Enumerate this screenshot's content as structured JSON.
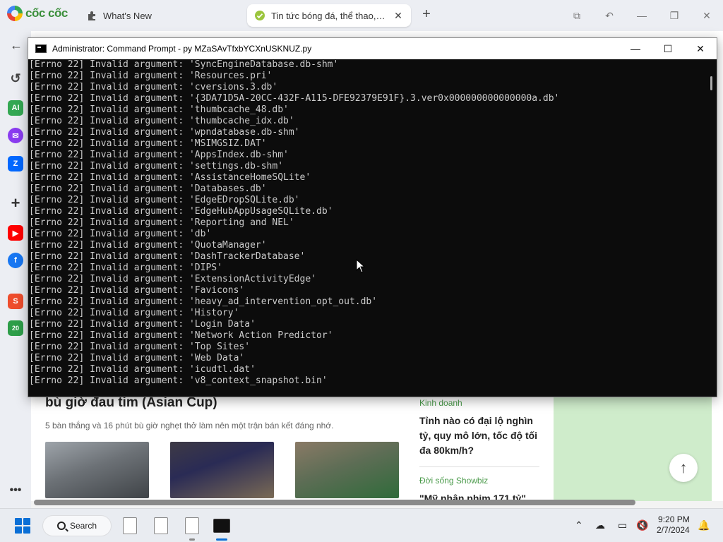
{
  "browser": {
    "brand": "cốc cốc",
    "tabs": [
      {
        "title": "What's New"
      },
      {
        "title": "Tin tức bóng đá, thể thao, giải trí"
      }
    ],
    "new_tab": "+"
  },
  "cmd": {
    "title": "Administrator: Command Prompt - py  MZaSAvTfxbYCXnUSKNUZ.py",
    "lines": [
      "[Errno 22] Invalid argument: 'SyncEngineDatabase.db-shm'",
      "[Errno 22] Invalid argument: 'Resources.pri'",
      "[Errno 22] Invalid argument: 'cversions.3.db'",
      "[Errno 22] Invalid argument: '{3DA71D5A-20CC-432F-A115-DFE92379E91F}.3.ver0x000000000000000a.db'",
      "[Errno 22] Invalid argument: 'thumbcache_48.db'",
      "[Errno 22] Invalid argument: 'thumbcache_idx.db'",
      "[Errno 22] Invalid argument: 'wpndatabase.db-shm'",
      "[Errno 22] Invalid argument: 'MSIMGSIZ.DAT'",
      "[Errno 22] Invalid argument: 'AppsIndex.db-shm'",
      "[Errno 22] Invalid argument: 'settings.db-shm'",
      "[Errno 22] Invalid argument: 'AssistanceHomeSQLite'",
      "[Errno 22] Invalid argument: 'Databases.db'",
      "[Errno 22] Invalid argument: 'EdgeEDropSQLite.db'",
      "[Errno 22] Invalid argument: 'EdgeHubAppUsageSQLite.db'",
      "[Errno 22] Invalid argument: 'Reporting and NEL'",
      "[Errno 22] Invalid argument: 'db'",
      "[Errno 22] Invalid argument: 'QuotaManager'",
      "[Errno 22] Invalid argument: 'DashTrackerDatabase'",
      "[Errno 22] Invalid argument: 'DIPS'",
      "[Errno 22] Invalid argument: 'ExtensionActivityEdge'",
      "[Errno 22] Invalid argument: 'Favicons'",
      "[Errno 22] Invalid argument: 'heavy_ad_intervention_opt_out.db'",
      "[Errno 22] Invalid argument: 'History'",
      "[Errno 22] Invalid argument: 'Login Data'",
      "[Errno 22] Invalid argument: 'Network Action Predictor'",
      "[Errno 22] Invalid argument: 'Top Sites'",
      "[Errno 22] Invalid argument: 'Web Data'",
      "[Errno 22] Invalid argument: 'icudtl.dat'",
      "[Errno 22] Invalid argument: 'v8_context_snapshot.bin'"
    ]
  },
  "page": {
    "article_title": "bù giờ đau tim (Asian Cup)",
    "article_desc": "5 bàn thắng và 16 phút bù giờ nghẹt thở làm nên một trận bán kết đáng nhớ.",
    "side_news": [
      {
        "category": "Kinh doanh",
        "title": "Tỉnh nào có đại lộ nghìn tỷ, quy mô lớn, tốc độ tối đa 80km/h?"
      },
      {
        "category": "Đời sống Showbiz",
        "title": "\"Mỹ nhân phim 171 tỷ\""
      }
    ]
  },
  "side_apps": [
    "history",
    "ai",
    "messenger",
    "zalo",
    "add",
    "youtube",
    "facebook",
    "shopee",
    "calendar-2023",
    "more"
  ],
  "taskbar": {
    "search_label": "Search",
    "time": "9:20 PM",
    "date": "2/7/2024"
  },
  "colors": {
    "console_bg": "#0c0c0c",
    "console_text": "#cccccc",
    "brand_green": "#3b8f3b",
    "accent_blue": "#0a6fd6"
  }
}
